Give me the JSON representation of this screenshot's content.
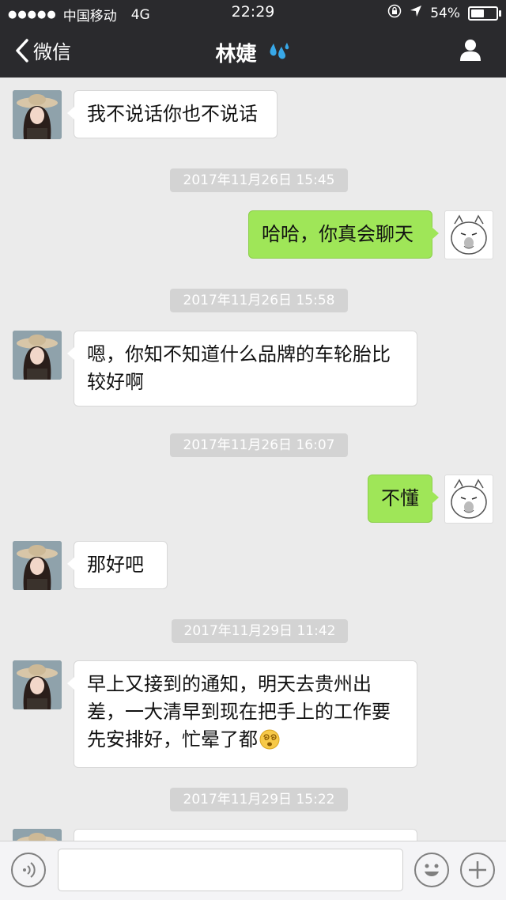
{
  "status_bar": {
    "carrier": "中国移动",
    "network": "4G",
    "time": "22:29",
    "battery_text": "54%",
    "battery_level": 0.54
  },
  "nav": {
    "back_label": "微信",
    "title": "林婕"
  },
  "messages": [
    {
      "type": "in",
      "text": "我不说话你也不说话"
    },
    {
      "type": "timestamp",
      "text": "2017年11月26日 15:45"
    },
    {
      "type": "out",
      "text": "哈哈，你真会聊天"
    },
    {
      "type": "timestamp",
      "text": "2017年11月26日 15:58"
    },
    {
      "type": "in",
      "text": "嗯，你知不知道什么品牌的车轮胎比较好啊"
    },
    {
      "type": "timestamp",
      "text": "2017年11月26日 16:07"
    },
    {
      "type": "out",
      "text": "不懂"
    },
    {
      "type": "in",
      "text": "那好吧"
    },
    {
      "type": "timestamp",
      "text": "2017年11月29日 11:42"
    },
    {
      "type": "in",
      "text": "早上又接到的通知，明天去贵州出差，一大清早到现在把手上的工作要先安排好，忙晕了都",
      "emoji": "dizzy-face"
    },
    {
      "type": "timestamp",
      "text": "2017年11月29日 15:22"
    }
  ],
  "input_bar": {
    "value": "",
    "icons": [
      "voice-icon",
      "emoji-icon",
      "plus-icon"
    ]
  },
  "colors": {
    "nav_bg": "#2a2a2d",
    "chat_bg": "#ebebeb",
    "outgoing_bubble": "#9fe658",
    "incoming_bubble": "#ffffff",
    "timestamp_bg": "#d3d3d3"
  }
}
